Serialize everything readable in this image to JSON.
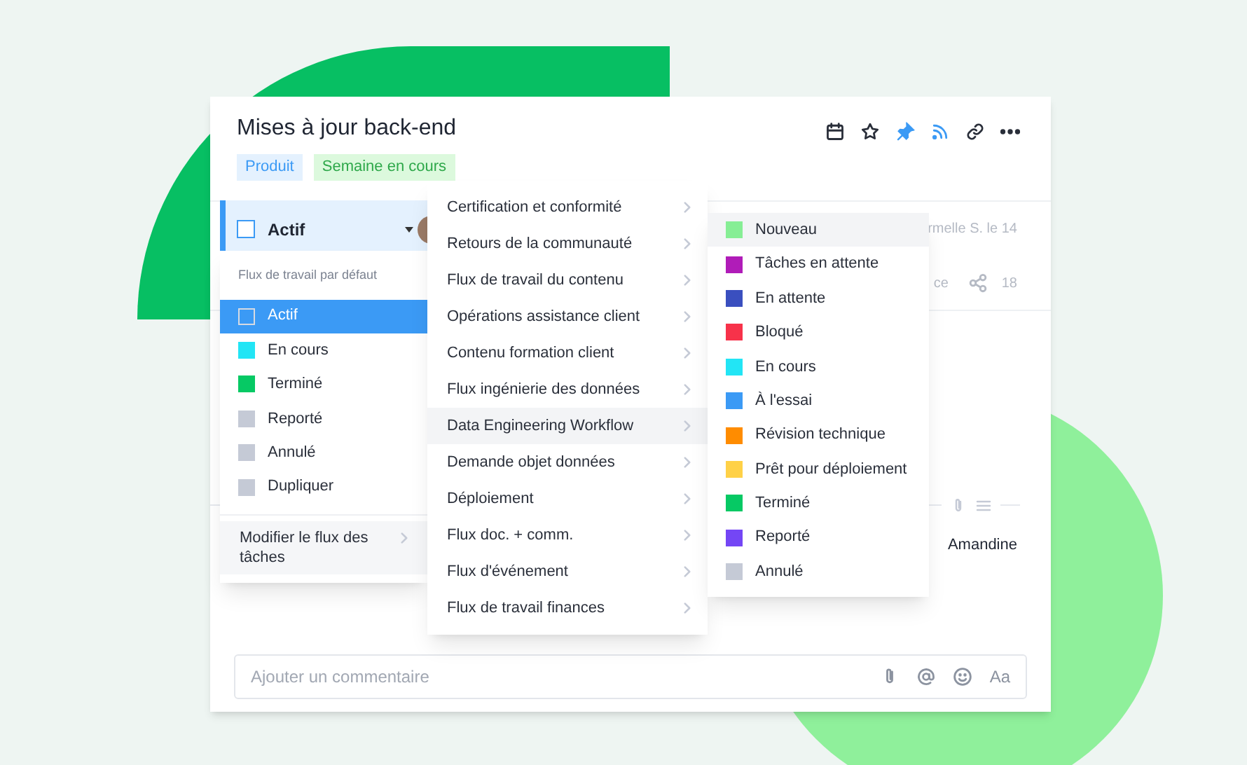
{
  "card": {
    "title": "Mises à jour back-end",
    "tags": [
      {
        "label": "Produit",
        "color": "#3b9af5"
      },
      {
        "label": "Semaine en cours",
        "color": "#2ea84a"
      }
    ],
    "header_icons": [
      {
        "active": false
      },
      {
        "active": false
      },
      {
        "active": true
      },
      {
        "active": true
      },
      {
        "active": false
      },
      {
        "active": false
      }
    ],
    "status": {
      "label": "Actif",
      "checked": false
    },
    "row_1": {
      "text": "rmelle S. le 14"
    },
    "row_2": {
      "text": "ce",
      "count": "18"
    },
    "assignee": "Amandine",
    "comment": {
      "placeholder": "Ajouter un commentaire",
      "format_label": "Aa"
    }
  },
  "status_menu": {
    "header": "Flux de travail par défaut",
    "items": [
      {
        "label": "Actif",
        "selected": true
      },
      {
        "label": "En cours",
        "color": "#22e5f5",
        "selected": false
      },
      {
        "label": "Terminé",
        "color": "#06c964",
        "selected": false
      },
      {
        "label": "Reporté",
        "color": "#c5cad6",
        "selected": false
      },
      {
        "label": "Annulé",
        "color": "#c5cad6",
        "selected": false
      },
      {
        "label": "Dupliquer",
        "color": "#c5cad6",
        "selected": false
      }
    ],
    "footer": "Modifier le flux des tâches"
  },
  "workflow_menu": {
    "items": [
      {
        "label": "Certification et conformité",
        "selected": false
      },
      {
        "label": "Retours de la communauté",
        "selected": false
      },
      {
        "label": "Flux de travail du contenu",
        "selected": false
      },
      {
        "label": "Opérations assistance client",
        "selected": false
      },
      {
        "label": "Contenu formation client",
        "selected": false
      },
      {
        "label": "Flux ingénierie des données",
        "selected": false
      },
      {
        "label": "Data Engineering Workflow",
        "selected": true
      },
      {
        "label": "Demande objet données",
        "selected": false
      },
      {
        "label": "Déploiement",
        "selected": false
      },
      {
        "label": "Flux doc. + comm.",
        "selected": false
      },
      {
        "label": "Flux d'événement",
        "selected": false
      },
      {
        "label": "Flux de travail finances",
        "selected": false
      }
    ]
  },
  "status_submenu": {
    "items": [
      {
        "label": "Nouveau",
        "color": "#86ee95",
        "selected": true
      },
      {
        "label": "Tâches en attente",
        "color": "#b01cb8",
        "selected": false
      },
      {
        "label": "En attente",
        "color": "#3a4fbf",
        "selected": false
      },
      {
        "label": "Bloqué",
        "color": "#f7324a",
        "selected": false
      },
      {
        "label": "En cours",
        "color": "#22e5f5",
        "selected": false
      },
      {
        "label": "À l'essai",
        "color": "#3b9af5",
        "selected": false
      },
      {
        "label": "Révision technique",
        "color": "#ff8c00",
        "selected": false
      },
      {
        "label": "Prêt pour déploiement",
        "color": "#ffd147",
        "selected": false
      },
      {
        "label": "Terminé",
        "color": "#06c964",
        "selected": false
      },
      {
        "label": "Reporté",
        "color": "#7446f5",
        "selected": false
      },
      {
        "label": "Annulé",
        "color": "#c5cad6",
        "selected": false
      }
    ]
  }
}
